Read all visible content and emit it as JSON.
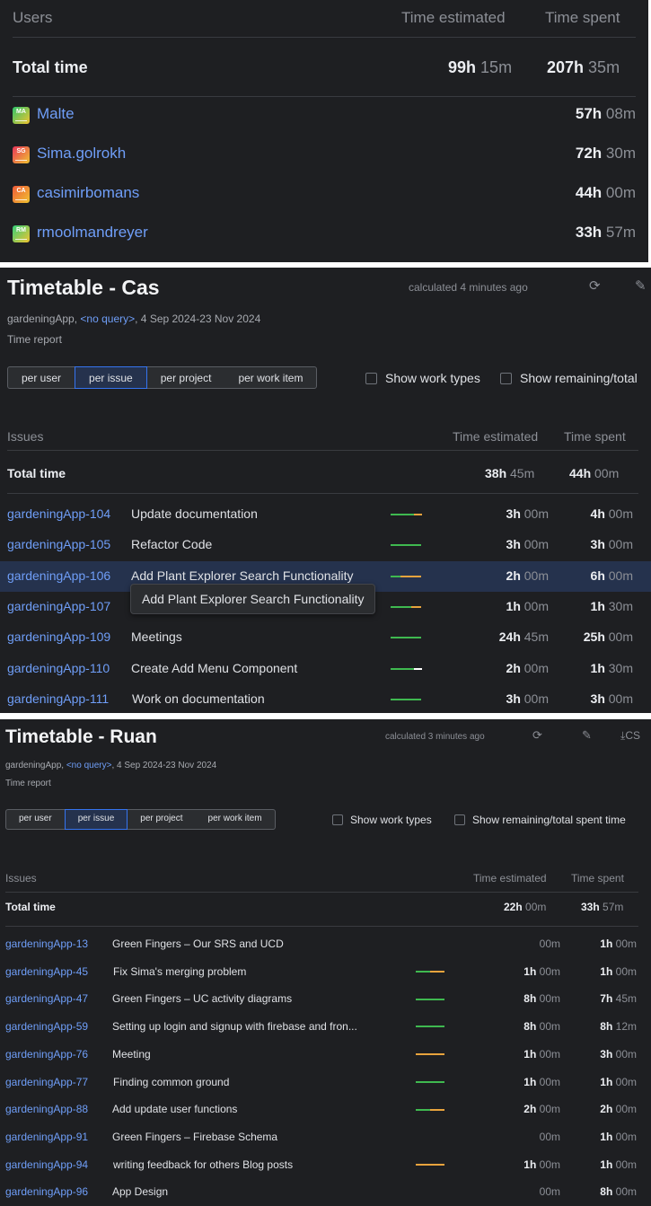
{
  "users_panel": {
    "headers": {
      "name": "Users",
      "estimated": "Time estimated",
      "spent": "Time spent"
    },
    "total": {
      "label": "Total time",
      "estimated_h": "99h",
      "estimated_m": "15m",
      "spent_h": "207h",
      "spent_m": "35m"
    },
    "users": [
      {
        "initials": "MA",
        "name": "Malte",
        "spent_h": "57h",
        "spent_m": "08m",
        "color": "#2fc56a"
      },
      {
        "initials": "SG",
        "name": "Sima.golrokh",
        "spent_h": "72h",
        "spent_m": "30m",
        "color": "#e8345a"
      },
      {
        "initials": "CA",
        "name": "casimirbomans",
        "spent_h": "44h",
        "spent_m": "00m",
        "color": "#ef5a3a"
      },
      {
        "initials": "RM",
        "name": "rmoolmandreyer",
        "spent_h": "33h",
        "spent_m": "57m",
        "color": "#35d07a"
      }
    ]
  },
  "cas_panel": {
    "title": "Timetable - Cas",
    "calculated": "calculated 4 minutes ago",
    "meta_project": "gardeningApp,",
    "meta_query": "<no query>",
    "meta_dates": ", 4 Sep 2024-23 Nov 2024",
    "subtitle": "Time report",
    "tabs": [
      "per user",
      "per issue",
      "per project",
      "per work item"
    ],
    "active_tab": "per issue",
    "checkbox_work_types": "Show work types",
    "checkbox_remaining": "Show remaining/total",
    "headers": {
      "name": "Issues",
      "estimated": "Time estimated",
      "spent": "Time spent"
    },
    "total": {
      "label": "Total time",
      "estimated_h": "38h",
      "estimated_m": "45m",
      "spent_h": "44h",
      "spent_m": "00m"
    },
    "issues": [
      {
        "key": "gardeningApp-104",
        "summary": "Update documentation",
        "est_h": "3h",
        "est_m": "00m",
        "spent_h": "4h",
        "spent_m": "00m",
        "bar_green": 0.75,
        "bar_orange": 0.25
      },
      {
        "key": "gardeningApp-105",
        "summary": "Refactor Code",
        "est_h": "3h",
        "est_m": "00m",
        "spent_h": "3h",
        "spent_m": "00m",
        "bar_green": 1.0,
        "bar_orange": 0
      },
      {
        "key": "gardeningApp-106",
        "summary": "Add Plant Explorer Search Functionality",
        "est_h": "2h",
        "est_m": "00m",
        "spent_h": "6h",
        "spent_m": "00m",
        "bar_green": 0.33,
        "bar_orange": 0.67
      },
      {
        "key": "gardeningApp-107",
        "summary": "",
        "est_h": "1h",
        "est_m": "00m",
        "spent_h": "1h",
        "spent_m": "30m",
        "bar_green": 0.67,
        "bar_orange": 0.33
      },
      {
        "key": "gardeningApp-109",
        "summary": "Meetings",
        "est_h": "24h",
        "est_m": "45m",
        "spent_h": "25h",
        "spent_m": "00m",
        "bar_green": 1.0,
        "bar_orange": 0
      },
      {
        "key": "gardeningApp-110",
        "summary": "Create Add Menu Component",
        "est_h": "2h",
        "est_m": "00m",
        "spent_h": "1h",
        "spent_m": "30m",
        "bar_green": 0.75,
        "bar_orange": 0,
        "bar_white": 0.25
      },
      {
        "key": "gardeningApp-111",
        "summary": "Work on documentation",
        "est_h": "3h",
        "est_m": "00m",
        "spent_h": "3h",
        "spent_m": "00m",
        "bar_green": 1.0,
        "bar_orange": 0
      }
    ],
    "tooltip": "Add Plant Explorer Search Functionality"
  },
  "ruan_panel": {
    "title": "Timetable - Ruan",
    "calculated": "calculated 3 minutes ago",
    "export_label": "CS",
    "meta_project": "gardeningApp,",
    "meta_query": "<no query>",
    "meta_dates": ", 4 Sep 2024-23 Nov 2024",
    "subtitle": "Time report",
    "tabs": [
      "per user",
      "per issue",
      "per project",
      "per work item"
    ],
    "active_tab": "per issue",
    "checkbox_work_types": "Show work types",
    "checkbox_remaining": "Show remaining/total spent time",
    "headers": {
      "name": "Issues",
      "estimated": "Time estimated",
      "spent": "Time spent"
    },
    "total": {
      "label": "Total time",
      "estimated_h": "22h",
      "estimated_m": "00m",
      "spent_h": "33h",
      "spent_m": "57m"
    },
    "issues": [
      {
        "key": "gardeningApp-13",
        "summary": "Green Fingers – Our SRS and UCD",
        "est_h": "",
        "est_m": "00m",
        "spent_h": "1h",
        "spent_m": "00m",
        "bar_green": 0,
        "bar_orange": 0
      },
      {
        "key": "gardeningApp-45",
        "summary": "Fix Sima's merging problem",
        "est_h": "1h",
        "est_m": "00m",
        "spent_h": "1h",
        "spent_m": "00m",
        "bar_green": 0.5,
        "bar_orange": 0.5
      },
      {
        "key": "gardeningApp-47",
        "summary": "Green Fingers – UC activity diagrams",
        "est_h": "8h",
        "est_m": "00m",
        "spent_h": "7h",
        "spent_m": "45m",
        "bar_green": 1.0,
        "bar_orange": 0
      },
      {
        "key": "gardeningApp-59",
        "summary": "Setting up login and signup with firebase and fron...",
        "est_h": "8h",
        "est_m": "00m",
        "spent_h": "8h",
        "spent_m": "12m",
        "bar_green": 1.0,
        "bar_orange": 0
      },
      {
        "key": "gardeningApp-76",
        "summary": "Meeting",
        "est_h": "1h",
        "est_m": "00m",
        "spent_h": "3h",
        "spent_m": "00m",
        "bar_green": 0,
        "bar_orange": 1.0
      },
      {
        "key": "gardeningApp-77",
        "summary": "Finding common ground",
        "est_h": "1h",
        "est_m": "00m",
        "spent_h": "1h",
        "spent_m": "00m",
        "bar_green": 1.0,
        "bar_orange": 0
      },
      {
        "key": "gardeningApp-88",
        "summary": "Add update user functions",
        "est_h": "2h",
        "est_m": "00m",
        "spent_h": "2h",
        "spent_m": "00m",
        "bar_green": 0.5,
        "bar_orange": 0.5
      },
      {
        "key": "gardeningApp-91",
        "summary": "Green Fingers – Firebase Schema",
        "est_h": "",
        "est_m": "00m",
        "spent_h": "1h",
        "spent_m": "00m",
        "bar_green": 0,
        "bar_orange": 0
      },
      {
        "key": "gardeningApp-94",
        "summary": "writing feedback for others Blog posts",
        "est_h": "1h",
        "est_m": "00m",
        "spent_h": "1h",
        "spent_m": "00m",
        "bar_green": 0,
        "bar_orange": 1.0
      },
      {
        "key": "gardeningApp-96",
        "summary": "App Design",
        "est_h": "",
        "est_m": "00m",
        "spent_h": "8h",
        "spent_m": "00m",
        "bar_green": 0,
        "bar_orange": 0
      }
    ]
  },
  "colors": {
    "bg": "#1e1f22",
    "link": "#6f9ef8",
    "green": "#3fb950",
    "orange": "#e8a33d",
    "accent": "#3574f0"
  }
}
